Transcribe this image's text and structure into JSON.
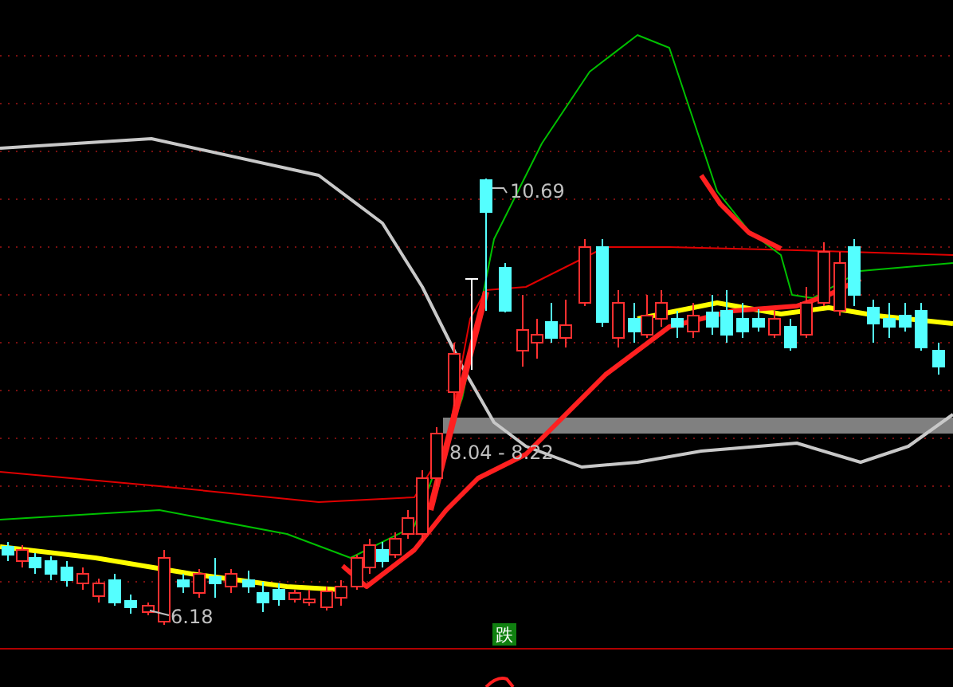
{
  "chart": {
    "high_label": "10.69",
    "zone_label": "8.04 - 8.22",
    "low_label": "6.18"
  },
  "signal_badge": "跌"
}
